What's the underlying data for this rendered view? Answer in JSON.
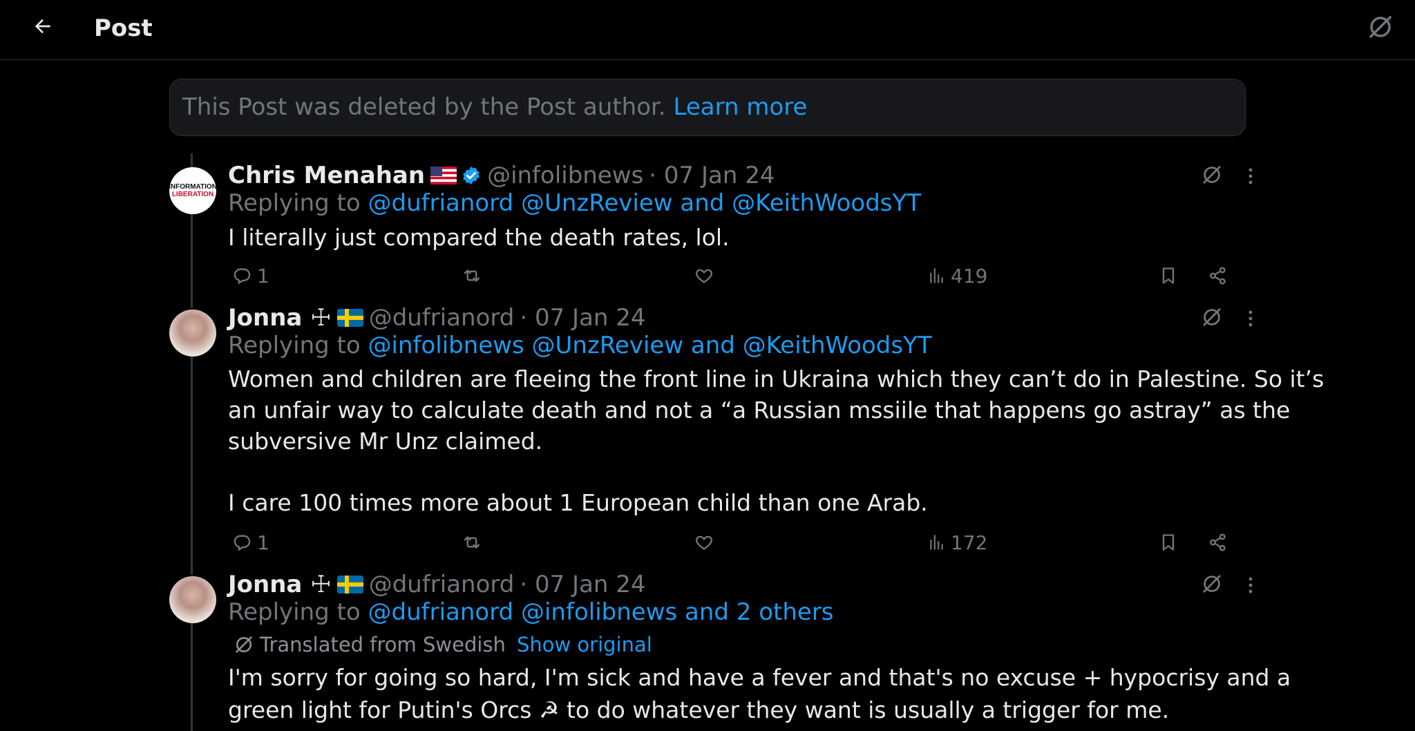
{
  "header": {
    "title": "Post"
  },
  "deleted_notice": {
    "text": "This Post was deleted by the Post author.",
    "link": "Learn more"
  },
  "posts": [
    {
      "name": "Chris Menahan",
      "handle": "@infolibnews",
      "date": "· 07 Jan 24",
      "replying_prefix": "Replying to",
      "mentions": "@dufrianord @UnzReview and @KeithWoodsYT",
      "lines": [
        "I literally just compared the death rates, lol."
      ],
      "replies": "1",
      "views": "419",
      "avatar_text": [
        "INFORMATION",
        "LIBERATION"
      ]
    },
    {
      "name": "Jonna ☩",
      "handle": "@dufrianord",
      "date": "· 07 Jan 24",
      "replying_prefix": "Replying to",
      "mentions": "@infolibnews @UnzReview and @KeithWoodsYT",
      "lines": [
        "Women and children are fleeing the front line in Ukraina which they can’t do in Palestine. So it’s",
        "an unfair way to calculate death and not a “a Russian mssiile that happens go astray” as the",
        "subversive Mr Unz claimed.",
        "I care 100 times more about 1 European child than one Arab."
      ],
      "replies": "1",
      "views": "172"
    },
    {
      "name": "Jonna ☩",
      "handle": "@dufrianord",
      "date": "· 07 Jan 24",
      "replying_prefix": "Replying to",
      "mentions": "@dufrianord @infolibnews and 2 others",
      "translated_label": "Translated from Swedish",
      "show_original": "Show original",
      "lines": [
        "I'm sorry for going so hard, I'm sick and have a fever and that's no excuse + hypocrisy and a",
        "green light for Putin's Orcs ☭ to do whatever they want is usually a trigger for me."
      ]
    }
  ],
  "colors": {
    "accent": "#1d9bf0",
    "muted": "#71767b",
    "text": "#e7e9ea",
    "background": "#000000"
  }
}
